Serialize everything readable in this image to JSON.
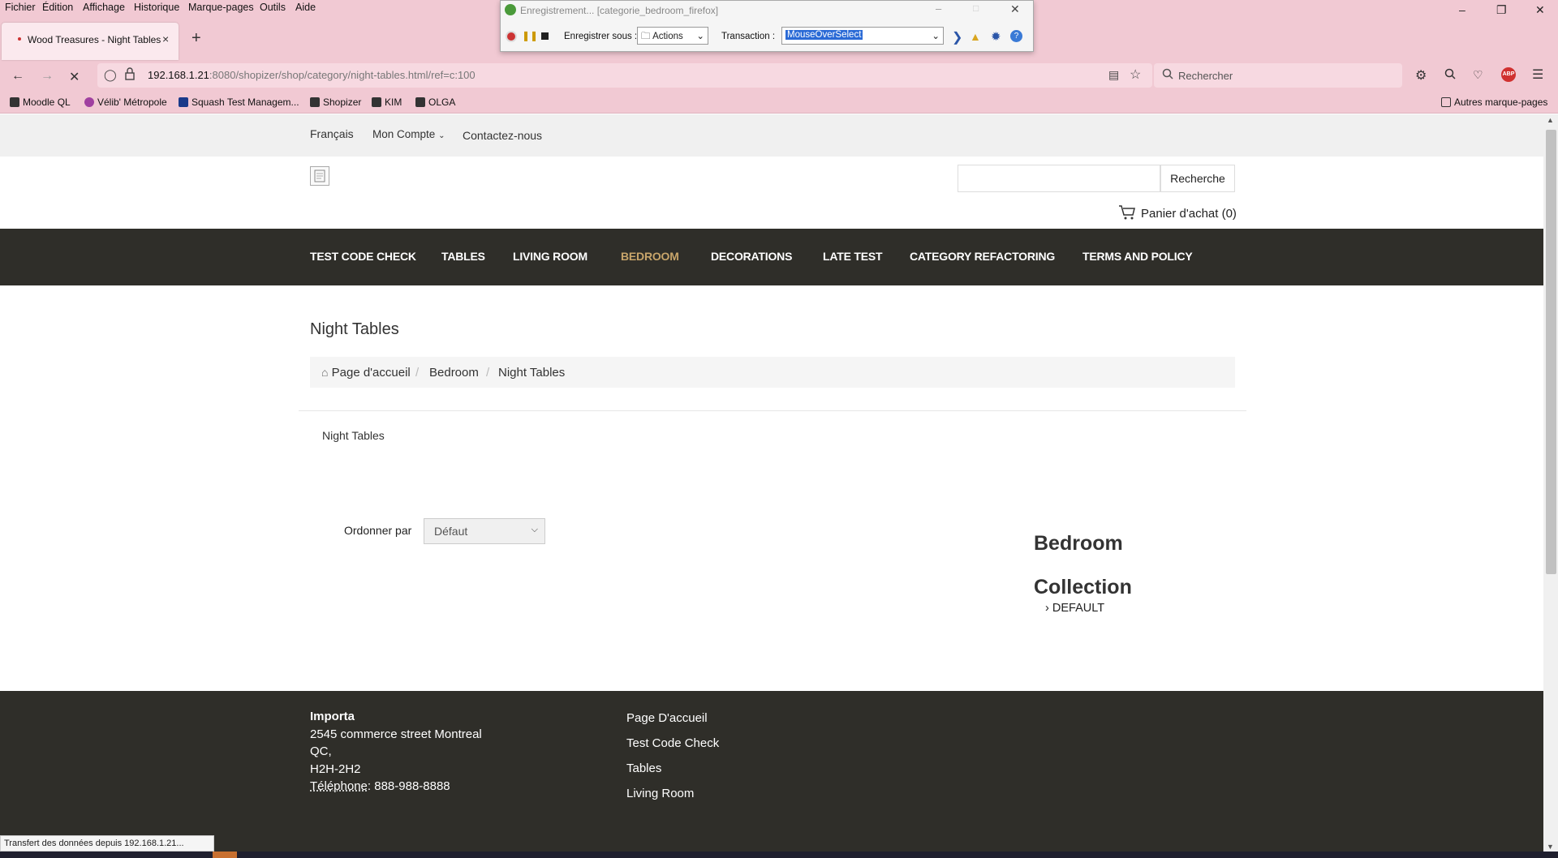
{
  "menubar": {
    "items": [
      "Fichier",
      "Édition",
      "Affichage",
      "Historique",
      "Marque-pages",
      "Outils",
      "Aide"
    ]
  },
  "tab": {
    "title": "Wood Treasures - Night Tables",
    "close": "×"
  },
  "newtab": "+",
  "url": {
    "host": "192.168.1.21",
    "rest": ":8080/shopizer/shop/category/night-tables.html/ref=c:100"
  },
  "searchbar": {
    "placeholder": "Rechercher"
  },
  "bookmarks": {
    "items": [
      "Moodle QL",
      "Vélib' Métropole",
      "Squash Test Managem...",
      "Shopizer",
      "KIM",
      "OLGA"
    ],
    "other": "Autres marque-pages"
  },
  "recorder": {
    "caption": "Enregistrement... [categorie_bedroom_firefox]",
    "save_label": "Enregistrer sous :",
    "save_value": "Actions",
    "transaction_label": "Transaction :",
    "transaction_value": "MouseOverSelect"
  },
  "site": {
    "top_links": [
      "Français",
      "Mon Compte",
      "Contactez-nous"
    ],
    "search_button": "Recherche",
    "cart": "Panier d'achat (0)",
    "nav": [
      "TEST CODE CHECK",
      "TABLES",
      "LIVING ROOM",
      "BEDROOM",
      "DECORATIONS",
      "LATE TEST",
      "CATEGORY REFACTORING",
      "TERMS AND POLICY"
    ],
    "active_nav": "BEDROOM",
    "page_title": "Night Tables",
    "breadcrumb": [
      "Page d'accueil",
      "Bedroom",
      "Night Tables"
    ],
    "category_description": "Night Tables",
    "order_by_label": "Ordonner par",
    "order_by_value": "Défaut",
    "side_title": "Bedroom Collection",
    "side_item": "DEFAULT"
  },
  "footer": {
    "company": "Importa",
    "address1": "2545 commerce street Montreal",
    "address2": "QC,",
    "postal": "H2H-2H2",
    "phone_label": "Téléphone",
    "phone": ": 888-988-8888",
    "links": [
      "Page D'accueil",
      "Test Code Check",
      "Tables",
      "Living Room"
    ]
  },
  "status": "Transfert des données depuis 192.168.1.21..."
}
